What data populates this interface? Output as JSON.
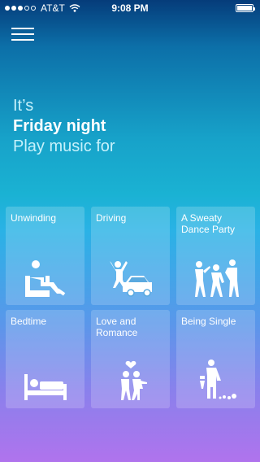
{
  "status": {
    "carrier": "AT&T",
    "time": "9:08 PM",
    "battery_level": 1.0
  },
  "header": {
    "line1": "It’s",
    "line2": "Friday night",
    "line3": "Play music for"
  },
  "tiles": [
    {
      "label": "Unwinding",
      "icon": "unwinding-icon"
    },
    {
      "label": "Driving",
      "icon": "driving-icon"
    },
    {
      "label": "A Sweaty Dance Party",
      "icon": "dance-party-icon"
    },
    {
      "label": "Bedtime",
      "icon": "bedtime-icon"
    },
    {
      "label": "Love and Romance",
      "icon": "romance-icon"
    },
    {
      "label": "Being Single",
      "icon": "single-icon"
    }
  ]
}
